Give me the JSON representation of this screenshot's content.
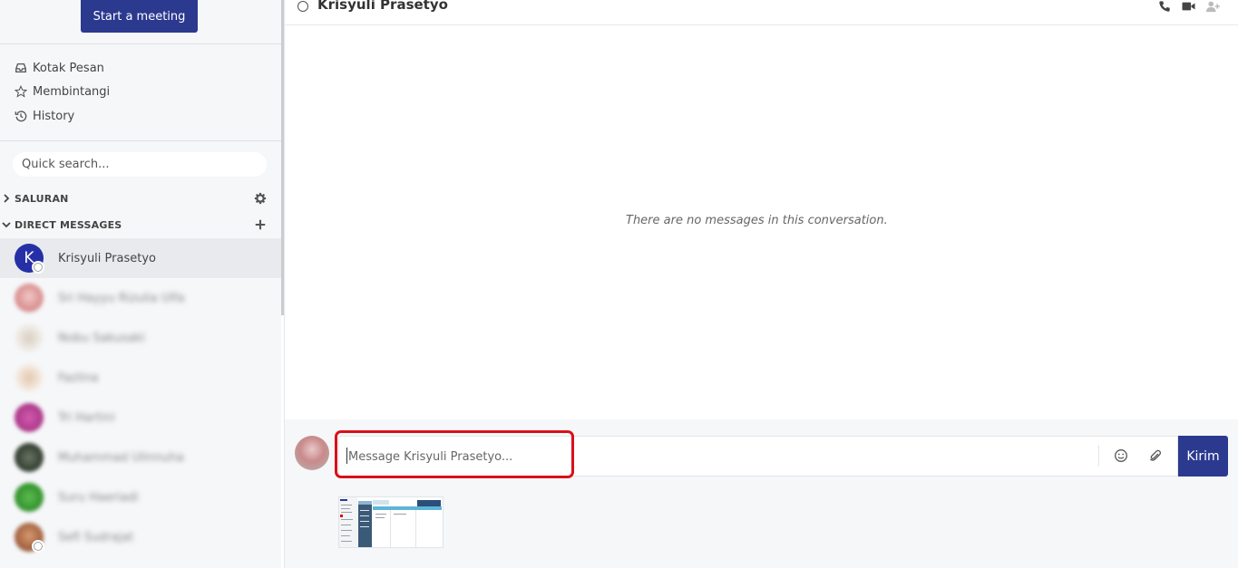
{
  "sidebar": {
    "start_meeting": "Start a meeting",
    "nav": [
      {
        "label": "Kotak Pesan",
        "icon": "inbox-icon"
      },
      {
        "label": "Membintangi",
        "icon": "star-icon"
      },
      {
        "label": "History",
        "icon": "history-icon"
      }
    ],
    "search_placeholder": "Quick search...",
    "sections": {
      "channels": "SALURAN",
      "direct_messages": "DIRECT MESSAGES"
    },
    "dms": [
      {
        "name": "Krisyuli Prasetyo",
        "avatar_letter": "K",
        "active": true,
        "avatar_color": "#2630a6"
      },
      {
        "name": "Sri Hayyu Rizulia Ulfa",
        "blurred": true,
        "avatar_color": "#e7b5b5"
      },
      {
        "name": "Nobu Sakusaki",
        "blurred": true,
        "avatar_color": "#e8e2da"
      },
      {
        "name": "Fazlina",
        "blurred": true,
        "avatar_color": "#e9d7c9"
      },
      {
        "name": "Tri Hartini",
        "blurred": true,
        "avatar_color": "#b03a8c"
      },
      {
        "name": "Muhammad Ulinnuha",
        "blurred": true,
        "avatar_color": "#3f4a3d"
      },
      {
        "name": "Suru Haeriadi",
        "blurred": true,
        "avatar_color": "#3f9f3a"
      },
      {
        "name": "Sefi Sudrajat",
        "blurred": true,
        "avatar_color": "#b9774e"
      }
    ]
  },
  "header": {
    "title": "Krisyuli Prasetyo"
  },
  "conversation": {
    "empty_text": "There are no messages in this conversation."
  },
  "composer": {
    "placeholder": "Message Krisyuli Prasetyo...",
    "send_label": "Kirim"
  },
  "colors": {
    "primary": "#2b3a8f",
    "highlight": "#d9101a"
  }
}
